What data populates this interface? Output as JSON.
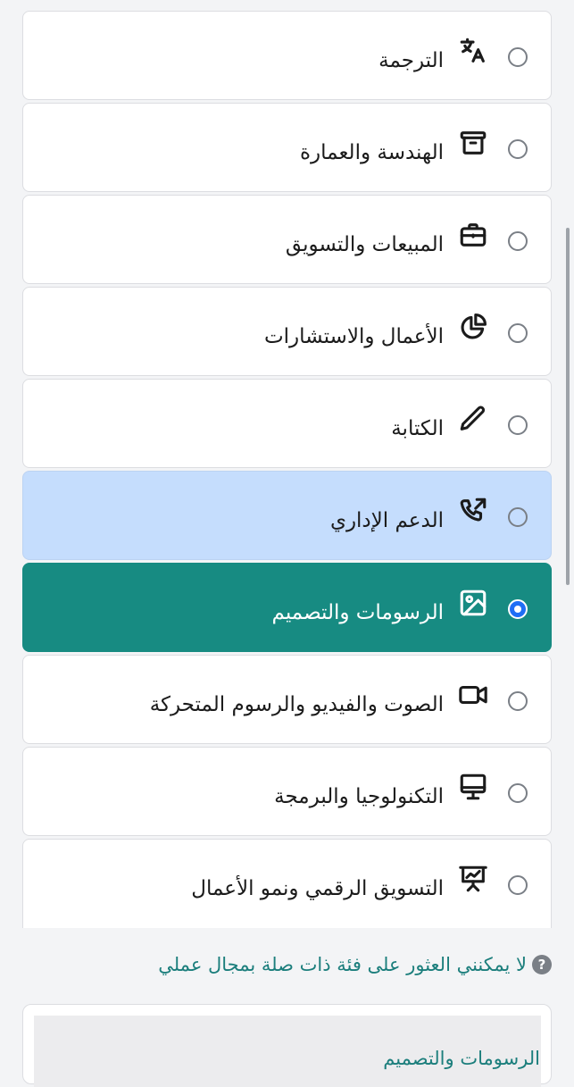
{
  "categories": [
    {
      "label": "الترجمة",
      "icon": "translate-icon",
      "state": "unselected"
    },
    {
      "label": "الهندسة والعمارة",
      "icon": "archive-box-icon",
      "state": "unselected"
    },
    {
      "label": "المبيعات والتسويق",
      "icon": "briefcase-icon",
      "state": "unselected"
    },
    {
      "label": "الأعمال والاستشارات",
      "icon": "pie-chart-icon",
      "state": "unselected"
    },
    {
      "label": "الكتابة",
      "icon": "pencil-icon",
      "state": "unselected"
    },
    {
      "label": "الدعم الإداري",
      "icon": "phone-outgoing-icon",
      "state": "hover"
    },
    {
      "label": "الرسومات والتصميم",
      "icon": "image-icon",
      "state": "selected"
    },
    {
      "label": "الصوت والفيديو والرسوم المتحركة",
      "icon": "video-camera-icon",
      "state": "unselected"
    },
    {
      "label": "التكنولوجيا والبرمجة",
      "icon": "monitor-icon",
      "state": "unselected"
    },
    {
      "label": "التسويق الرقمي ونمو الأعمال",
      "icon": "presentation-chart-icon",
      "state": "unselected"
    }
  ],
  "not_found_text": "لا يمكنني العثور على فئة ذات صلة بمجال عملي",
  "help_icon_glyph": "?",
  "selected_summary": "الرسومات والتصميم",
  "colors": {
    "selected_bg": "#178b82",
    "hover_bg": "#c5ddfd",
    "link_text": "#1b7e7c",
    "radio_dot": "#1f6ef5"
  }
}
